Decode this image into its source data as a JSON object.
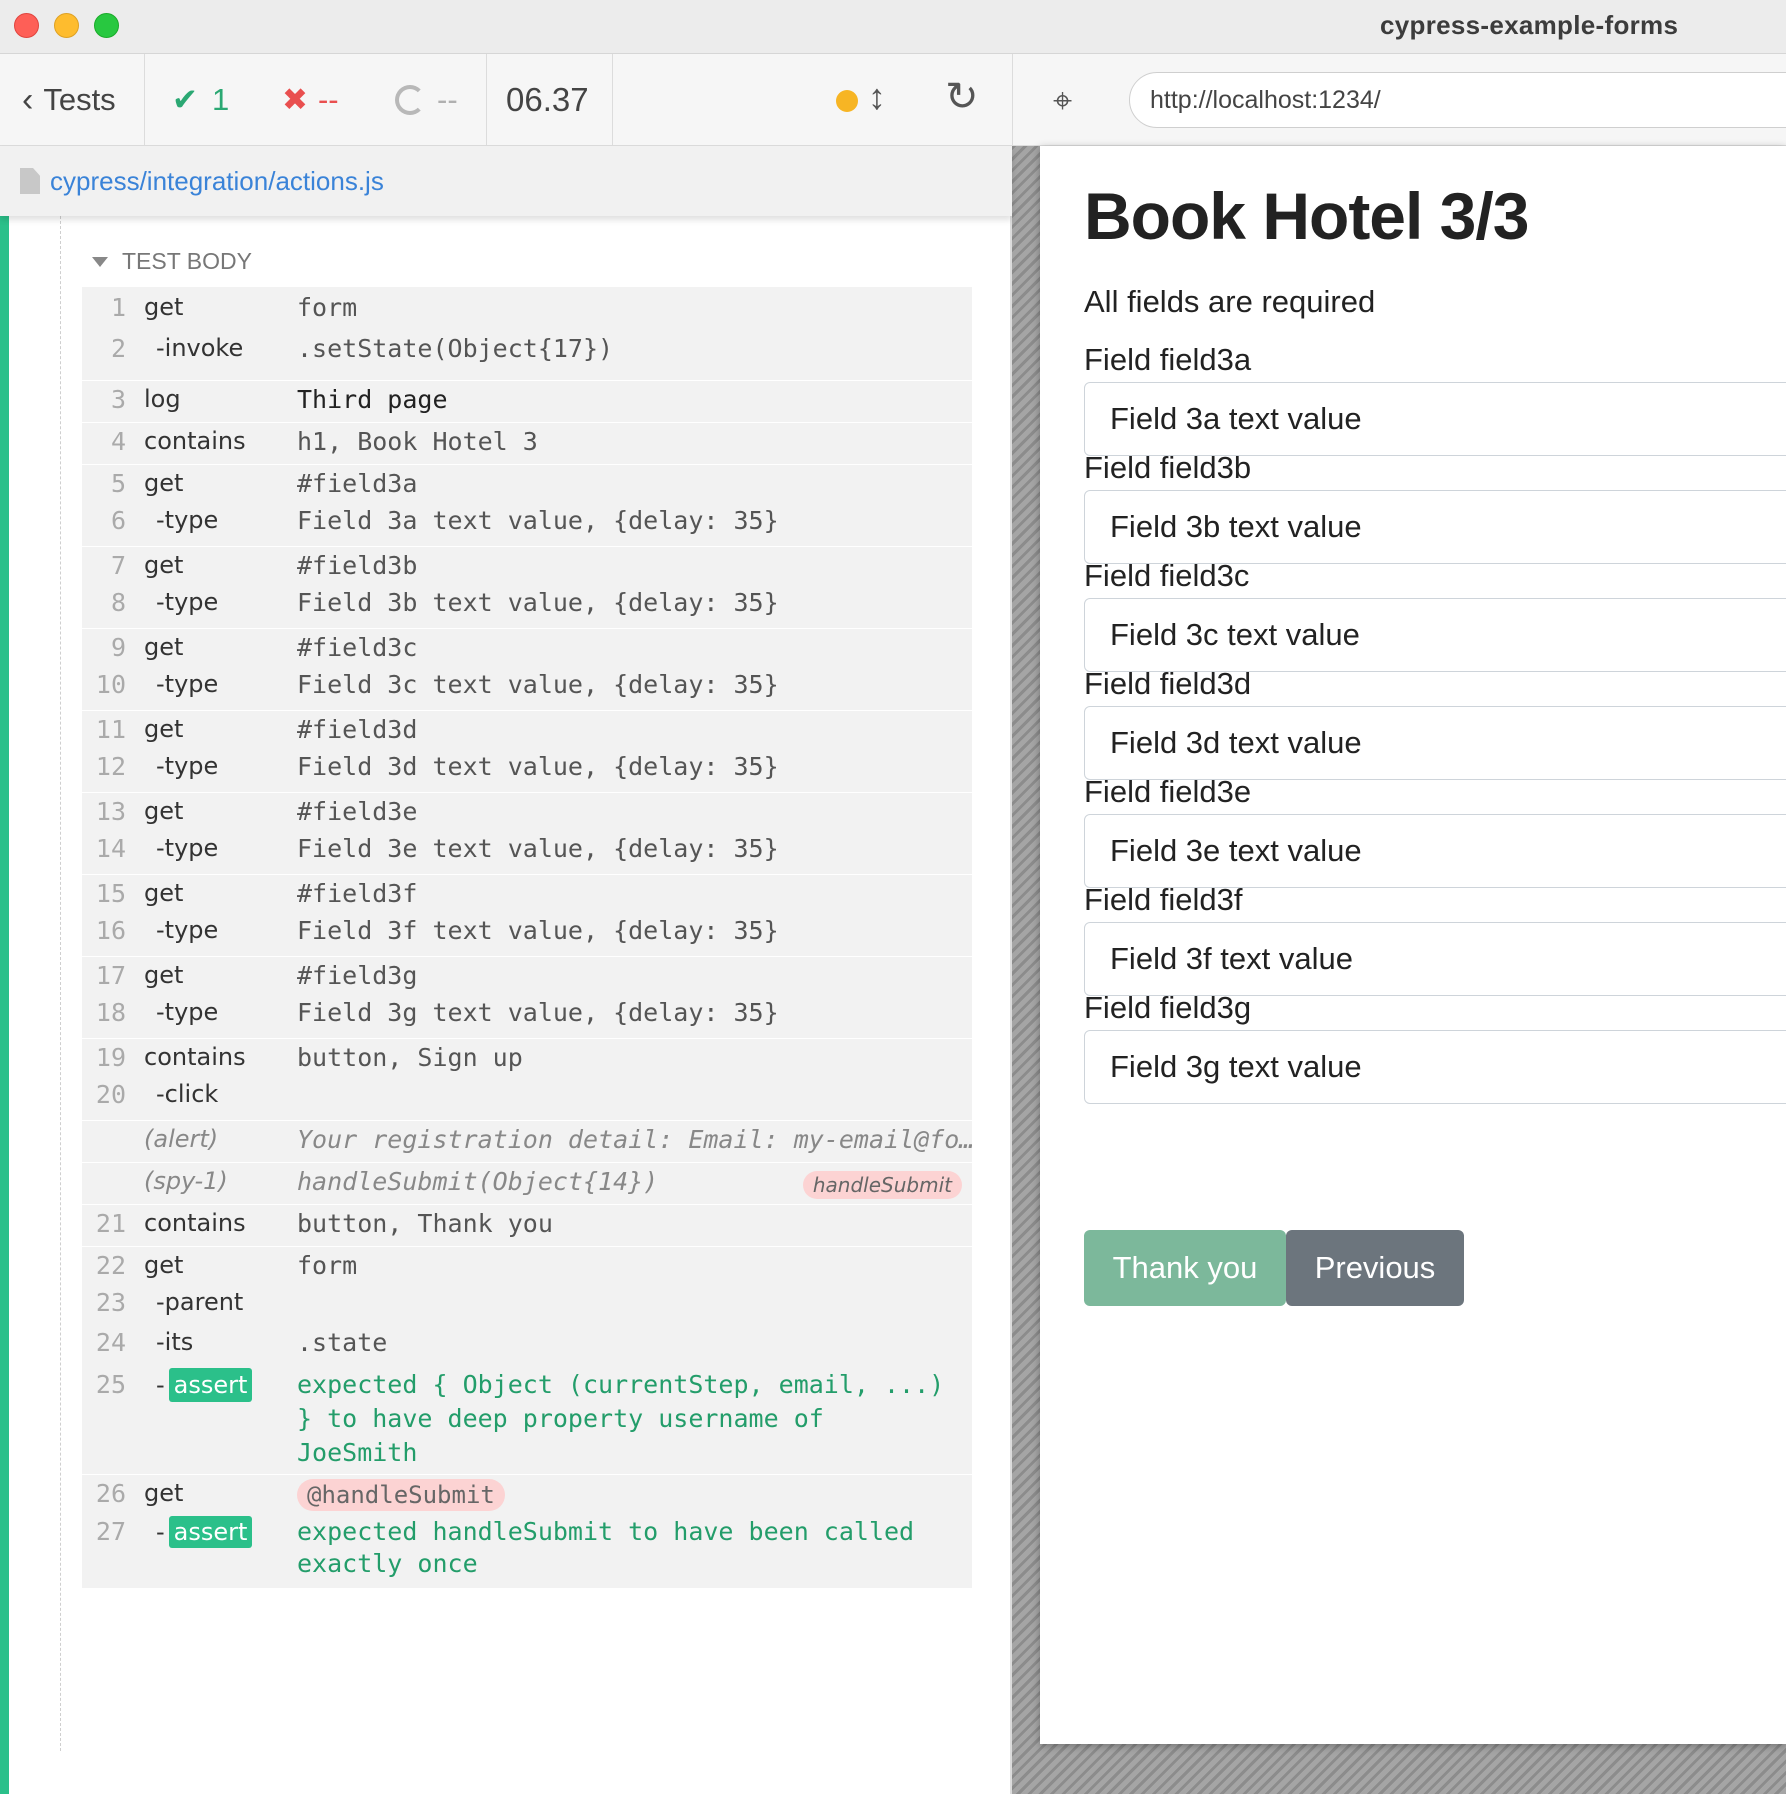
{
  "window": {
    "title": "cypress-example-forms"
  },
  "reporter": {
    "tests_label": "Tests",
    "passed": "1",
    "failed": "--",
    "pending": "--",
    "duration": "06.37",
    "spec_path": "cypress/integration/actions.js",
    "test_body_label": "TEST BODY",
    "commands": [
      {
        "num": "1",
        "name": "get",
        "msg": "form"
      },
      {
        "num": "2",
        "name": "-invoke",
        "msg": ".setState(Object{17})"
      },
      {
        "num": "3",
        "name": "log",
        "msg": "Third page"
      },
      {
        "num": "4",
        "name": "contains",
        "msg": "h1, Book Hotel 3"
      },
      {
        "num": "5",
        "name": "get",
        "msg": "#field3a"
      },
      {
        "num": "6",
        "name": "-type",
        "msg": "Field 3a text value, {delay: 35}"
      },
      {
        "num": "7",
        "name": "get",
        "msg": "#field3b"
      },
      {
        "num": "8",
        "name": "-type",
        "msg": "Field 3b text value, {delay: 35}"
      },
      {
        "num": "9",
        "name": "get",
        "msg": "#field3c"
      },
      {
        "num": "10",
        "name": "-type",
        "msg": "Field 3c text value, {delay: 35}"
      },
      {
        "num": "11",
        "name": "get",
        "msg": "#field3d"
      },
      {
        "num": "12",
        "name": "-type",
        "msg": "Field 3d text value, {delay: 35}"
      },
      {
        "num": "13",
        "name": "get",
        "msg": "#field3e"
      },
      {
        "num": "14",
        "name": "-type",
        "msg": "Field 3e text value, {delay: 35}"
      },
      {
        "num": "15",
        "name": "get",
        "msg": "#field3f"
      },
      {
        "num": "16",
        "name": "-type",
        "msg": "Field 3f text value, {delay: 35}"
      },
      {
        "num": "17",
        "name": "get",
        "msg": "#field3g"
      },
      {
        "num": "18",
        "name": "-type",
        "msg": "Field 3g text value, {delay: 35}"
      },
      {
        "num": "19",
        "name": "contains",
        "msg": "button, Sign up"
      },
      {
        "num": "20",
        "name": "-click",
        "msg": ""
      },
      {
        "num": "",
        "name": "(alert)",
        "msg": "Your registration detail: Email: my-email@fo…"
      },
      {
        "num": "",
        "name": "(spy-1)",
        "msg": "handleSubmit(Object{14})",
        "alias": "handleSubmit"
      },
      {
        "num": "21",
        "name": "contains",
        "msg": "button, Thank you"
      },
      {
        "num": "22",
        "name": "get",
        "msg": "form"
      },
      {
        "num": "23",
        "name": "-parent",
        "msg": ""
      },
      {
        "num": "24",
        "name": "-its",
        "msg": ".state"
      },
      {
        "num": "25",
        "name": "assert",
        "msg": "expected { Object (currentStep, email, ...) } to have deep property username of JoeSmith"
      },
      {
        "num": "26",
        "name": "get",
        "msg": "@handleSubmit"
      },
      {
        "num": "27",
        "name": "assert",
        "msg": "expected handleSubmit to have been called exactly once"
      }
    ]
  },
  "aut": {
    "url": "http://localhost:1234/",
    "heading": "Book Hotel 3/3",
    "subtitle": "All fields are required",
    "fields": [
      {
        "label": "Field field3a",
        "value": "Field 3a text value"
      },
      {
        "label": "Field field3b",
        "value": "Field 3b text value"
      },
      {
        "label": "Field field3c",
        "value": "Field 3c text value"
      },
      {
        "label": "Field field3d",
        "value": "Field 3d text value"
      },
      {
        "label": "Field field3e",
        "value": "Field 3e text value"
      },
      {
        "label": "Field field3f",
        "value": "Field 3f text value"
      },
      {
        "label": "Field field3g",
        "value": "Field 3g text value"
      }
    ],
    "primary_button": "Thank you",
    "secondary_button": "Previous"
  },
  "colors": {
    "pass": "#2ba873",
    "fail": "#e94f4f",
    "pending": "#b0b0b0",
    "running_dot": "#f7b524",
    "spec_link": "#3a83d8",
    "assert_badge": "#2bc08a",
    "alias_bg": "#fcd3d3",
    "primary_button": "#7cb89b",
    "secondary_button": "#6c757d"
  }
}
